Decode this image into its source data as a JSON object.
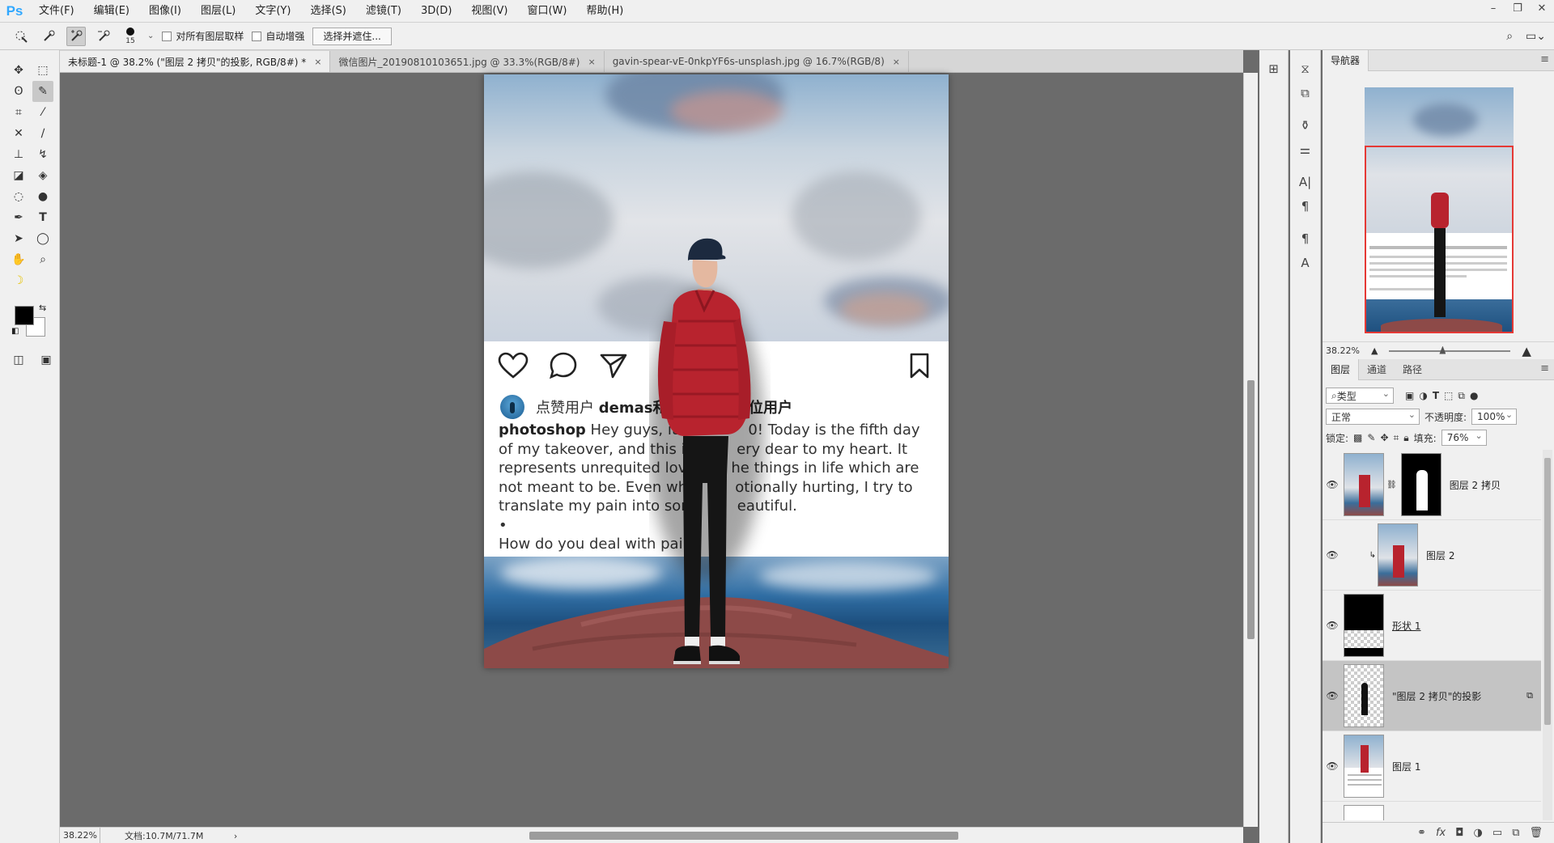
{
  "app": {
    "logo": "Ps"
  },
  "menu": [
    "文件(F)",
    "编辑(E)",
    "图像(I)",
    "图层(L)",
    "文字(Y)",
    "选择(S)",
    "滤镜(T)",
    "3D(D)",
    "视图(V)",
    "窗口(W)",
    "帮助(H)"
  ],
  "options": {
    "brush_size": "15",
    "sample_all_layers": "对所有图层取样",
    "auto_enhance": "自动增强",
    "select_mask_button": "选择并遮住..."
  },
  "tabs": [
    {
      "label": "未标题-1 @ 38.2% (\"图层 2 拷贝\"的投影, RGB/8#) *",
      "close": "×"
    },
    {
      "label": "微信图片_20190810103651.jpg @ 33.3%(RGB/8#)",
      "close": "×"
    },
    {
      "label": "gavin-spear-vE-0nkpYF6s-unsplash.jpg @ 16.7%(RGB/8)",
      "close": "×"
    }
  ],
  "artboard": {
    "likes_prefix": "点赞用户",
    "likes_user": "demas和其",
    "likes_suffix": "3位用户",
    "caption_user": "photoshop",
    "caption_line1": " Hey guys, it's r",
    "caption_line1b": "0! Today is the fifth day",
    "caption_line2a": "of my takeover, and this in",
    "caption_line2b": "ery dear to my heart. It",
    "caption_line3a": "represents unrequited love",
    "caption_line3b": "he things in life which are",
    "caption_line4a": "not meant to be. Even whe",
    "caption_line4b": "otionally hurting, I try to",
    "caption_line5a": "translate my pain into som",
    "caption_line5b": "eautiful.",
    "caption_bullet": "•",
    "caption_last": "How do you deal with pair"
  },
  "status": {
    "zoom": "38.22%",
    "doc": "文档:10.7M/71.7M",
    "arrow": "›"
  },
  "navigator": {
    "tab": "导航器",
    "zoom": "38.22%"
  },
  "layers_panel": {
    "tabs": [
      "图层",
      "通道",
      "路径"
    ],
    "filter": "类型",
    "blend_mode": "正常",
    "opacity_label": "不透明度:",
    "opacity_value": "100%",
    "lock_label": "锁定:",
    "fill_label": "填充:",
    "fill_value": "76%",
    "layers": [
      {
        "name": "图层 2 拷贝"
      },
      {
        "name": "图层 2"
      },
      {
        "name": "形状 1"
      },
      {
        "name": "\"图层 2 拷贝\"的投影"
      },
      {
        "name": "图层 1"
      }
    ]
  },
  "colors": {
    "accent": "#31a8ff",
    "jacket": "#b8232e",
    "nav_box": "#e53935"
  }
}
